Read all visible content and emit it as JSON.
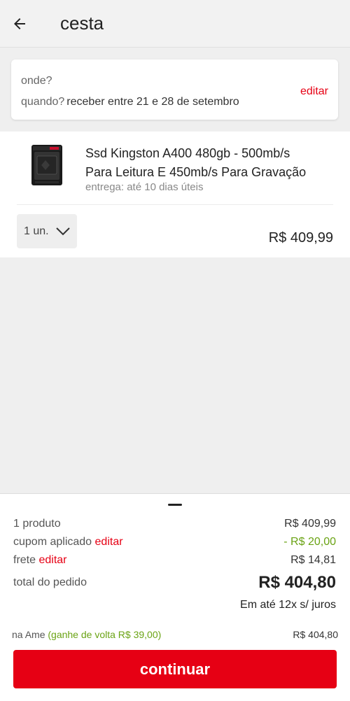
{
  "header": {
    "title": "cesta",
    "back_icon": "arrow-left-icon"
  },
  "delivery": {
    "where_label": "onde?",
    "when_label": "quando?",
    "when_value": "receber entre 21 e 28 de setembro",
    "edit_label": "editar"
  },
  "cart": {
    "items": [
      {
        "name": "Ssd Kingston A400 480gb - 500mb/s Para Leitura E 450mb/s Para Gravação",
        "delivery": "entrega: até 10 dias úteis",
        "quantity": "1 un.",
        "price": "R$ 409,99",
        "image_icon": "ssd-product-image"
      }
    ]
  },
  "summary": {
    "products_label": "1 produto",
    "products_value": "R$ 409,99",
    "coupon_label": "cupom aplicado",
    "coupon_edit": "editar",
    "coupon_value": "- R$ 20,00",
    "shipping_label": "frete",
    "shipping_edit": "editar",
    "shipping_value": "R$ 14,81",
    "total_label": "total do pedido",
    "total_value": "R$ 404,80",
    "installments": "Em até 12x s/ juros",
    "ame_label": "na Ame",
    "ame_cashback": "(ganhe de volta R$ 39,00)",
    "ame_value": "R$ 404,80",
    "continue_label": "continuar"
  },
  "colors": {
    "brand": "#e60014",
    "green": "#6aa314",
    "background": "#efefef"
  }
}
